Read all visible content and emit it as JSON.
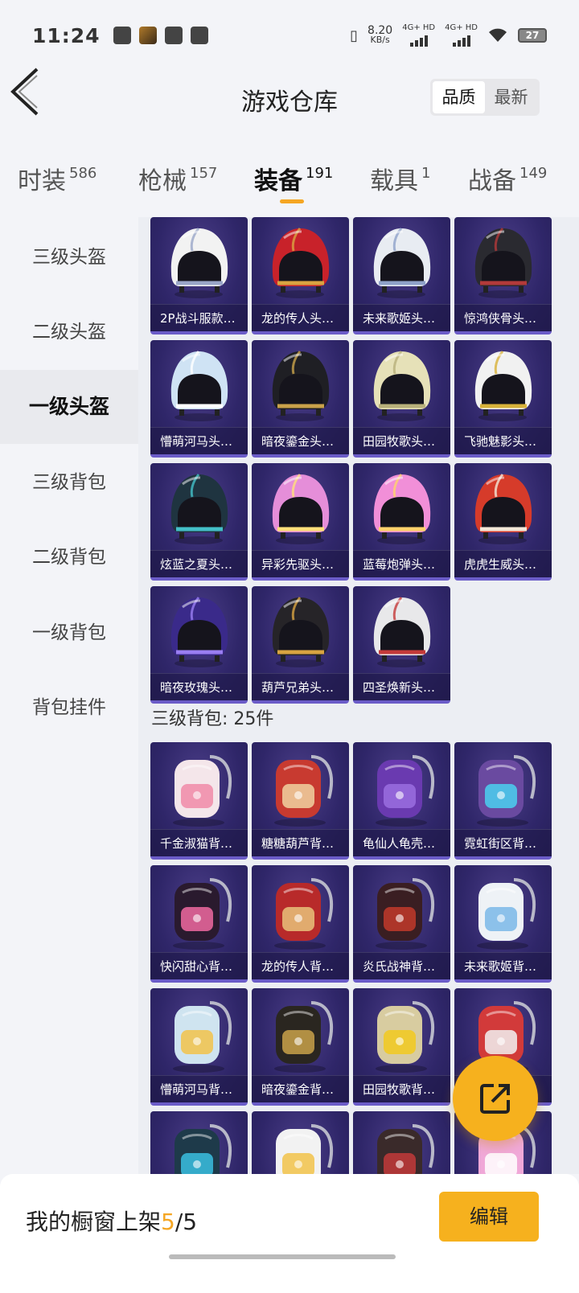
{
  "status_bar": {
    "time": "11:24",
    "speed_value": "8.20",
    "speed_unit": "KB/s",
    "net1": "4G+ HD",
    "net2": "4G+ HD",
    "battery": "27"
  },
  "header": {
    "title": "游戏仓库",
    "sort_options": [
      "品质",
      "最新"
    ],
    "active_sort": "品质"
  },
  "tabs": [
    {
      "label": "时装",
      "count": "586"
    },
    {
      "label": "枪械",
      "count": "157"
    },
    {
      "label": "装备",
      "count": "191",
      "active": true
    },
    {
      "label": "载具",
      "count": "1"
    },
    {
      "label": "战备",
      "count": "149"
    }
  ],
  "sidebar": {
    "items": [
      "三级头盔",
      "二级头盔",
      "一级头盔",
      "三级背包",
      "二级背包",
      "一级背包",
      "背包挂件"
    ],
    "active": "一级头盔"
  },
  "helmets": [
    {
      "label": "2P战斗服款…",
      "icon": "helmet-icon",
      "color": "#f2f2f2",
      "accent": "#9aa6c8"
    },
    {
      "label": "龙的传人头…",
      "icon": "helmet-icon",
      "color": "#c8222a",
      "accent": "#d9a441"
    },
    {
      "label": "未来歌姬头…",
      "icon": "helmet-icon",
      "color": "#e8ecf2",
      "accent": "#8fa2c9"
    },
    {
      "label": "惊鸿侠骨头…",
      "icon": "helmet-icon",
      "color": "#2a2a30",
      "accent": "#b33a3a"
    },
    {
      "label": "懵萌河马头…",
      "icon": "helmet-icon",
      "color": "#cfe3f4",
      "accent": "#ffffff"
    },
    {
      "label": "暗夜鎏金头…",
      "icon": "helmet-icon",
      "color": "#1f1f24",
      "accent": "#c9a24a"
    },
    {
      "label": "田园牧歌头…",
      "icon": "helmet-icon",
      "color": "#e6e1b8",
      "accent": "#b8b07a"
    },
    {
      "label": "飞驰魅影头…",
      "icon": "helmet-icon",
      "color": "#f1f1f1",
      "accent": "#d8b23a"
    },
    {
      "label": "炫蓝之夏头…",
      "icon": "helmet-icon",
      "color": "#1f3440",
      "accent": "#44c0c8"
    },
    {
      "label": "异彩先驱头…",
      "icon": "helmet-icon",
      "color": "#e58ed9",
      "accent": "#ffe07a"
    },
    {
      "label": "蓝莓炮弹头…",
      "icon": "helmet-icon",
      "color": "#f18fd8",
      "accent": "#ffd36b"
    },
    {
      "label": "虎虎生威头…",
      "icon": "helmet-icon",
      "color": "#d63b2a",
      "accent": "#f3e8d8"
    },
    {
      "label": "暗夜玫瑰头…",
      "icon": "helmet-icon",
      "color": "#3a2a8a",
      "accent": "#9a7ef2"
    },
    {
      "label": "葫芦兄弟头…",
      "icon": "helmet-icon",
      "color": "#262428",
      "accent": "#d9a441"
    },
    {
      "label": "四圣焕新头…",
      "icon": "helmet-icon",
      "color": "#e8e8ea",
      "accent": "#c43a3a"
    }
  ],
  "backpack_section": {
    "title": "三级背包: 25件"
  },
  "backpacks": [
    {
      "label": "千金淑猫背…",
      "icon": "backpack-icon",
      "color": "#f4e6ea",
      "accent": "#f08aa8"
    },
    {
      "label": "糖糖葫芦背…",
      "icon": "backpack-icon",
      "color": "#c83a30",
      "accent": "#f0d2a0"
    },
    {
      "label": "龟仙人龟壳…",
      "icon": "backpack-icon",
      "color": "#6a3ab0",
      "accent": "#9a6ee0"
    },
    {
      "label": "霓虹街区背…",
      "icon": "backpack-icon",
      "color": "#6a4aa0",
      "accent": "#4ad0f0"
    },
    {
      "label": "快闪甜心背…",
      "icon": "backpack-icon",
      "color": "#2a1a2e",
      "accent": "#f06aa0"
    },
    {
      "label": "龙的传人背…",
      "icon": "backpack-icon",
      "color": "#b82a2a",
      "accent": "#e8c27a"
    },
    {
      "label": "炎氏战神背…",
      "icon": "backpack-icon",
      "color": "#3a1e22",
      "accent": "#c23a2a"
    },
    {
      "label": "未来歌姬背…",
      "icon": "backpack-icon",
      "color": "#eef2f6",
      "accent": "#7ab8e8"
    },
    {
      "label": "懵萌河马背…",
      "icon": "backpack-icon",
      "color": "#cfe4f0",
      "accent": "#f2c34a"
    },
    {
      "label": "暗夜鎏金背…",
      "icon": "backpack-icon",
      "color": "#2a2620",
      "accent": "#c9a24a"
    },
    {
      "label": "田园牧歌背…",
      "icon": "backpack-icon",
      "color": "#d8cca0",
      "accent": "#f2c91e"
    },
    {
      "label": "",
      "icon": "backpack-icon",
      "color": "#d23a3a",
      "accent": "#f2f2f2"
    },
    {
      "label": "",
      "icon": "backpack-icon",
      "color": "#1e3a4a",
      "accent": "#3ac0e0"
    },
    {
      "label": "",
      "icon": "backpack-icon",
      "color": "#f2f2f2",
      "accent": "#f2c34a"
    },
    {
      "label": "",
      "icon": "backpack-icon",
      "color": "#3a2a2a",
      "accent": "#c23a3a"
    },
    {
      "label": "",
      "icon": "backpack-icon",
      "color": "#f0a8d8",
      "accent": "#ffffff"
    }
  ],
  "showcase": {
    "label": "我的橱窗上架",
    "current": "5",
    "separator": "/",
    "total": "5"
  },
  "edit_button": "编辑",
  "colors": {
    "accent": "#f5a623",
    "card_bg": "#2f2669",
    "card_border": "#6b5cc8"
  }
}
